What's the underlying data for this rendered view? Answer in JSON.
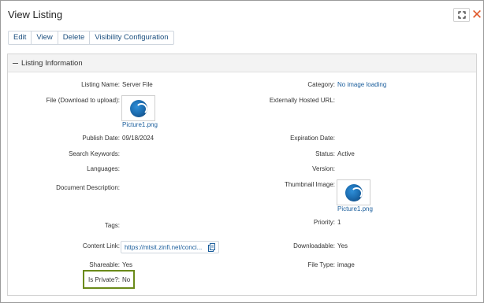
{
  "window": {
    "title": "View Listing"
  },
  "toolbar": {
    "edit": "Edit",
    "view": "View",
    "delete": "Delete",
    "visibility": "Visibility Configuration"
  },
  "panel": {
    "title": "Listing Information"
  },
  "fields": {
    "listing_name": {
      "label": "Listing Name:",
      "value": "Server File"
    },
    "category": {
      "label": "Category:",
      "value": "No image loading"
    },
    "file": {
      "label": "File (Download to upload):",
      "value": "Picture1.png"
    },
    "externally_hosted_url": {
      "label": "Externally Hosted URL:",
      "value": ""
    },
    "publish_date": {
      "label": "Publish Date:",
      "value": "09/18/2024"
    },
    "expiration_date": {
      "label": "Expiration Date:",
      "value": ""
    },
    "search_keywords": {
      "label": "Search Keywords:",
      "value": ""
    },
    "status": {
      "label": "Status:",
      "value": "Active"
    },
    "languages": {
      "label": "Languages:",
      "value": ""
    },
    "version": {
      "label": "Version:",
      "value": ""
    },
    "document_description": {
      "label": "Document Description:",
      "value": ""
    },
    "thumbnail_image": {
      "label": "Thumbnail Image:",
      "value": "Picture1.png"
    },
    "tags": {
      "label": "Tags:",
      "value": ""
    },
    "priority": {
      "label": "Priority:",
      "value": "1"
    },
    "content_link": {
      "label": "Content Link:",
      "value": "https://mtsit.zinfi.net/conci..."
    },
    "downloadable": {
      "label": "Downloadable:",
      "value": "Yes"
    },
    "shareable": {
      "label": "Shareable:",
      "value": "Yes"
    },
    "file_type": {
      "label": "File Type:",
      "value": "image"
    },
    "is_private": {
      "label": "Is Private?:",
      "value": "No"
    }
  },
  "icons": {
    "expand": "expand-icon",
    "close": "close-icon",
    "collapse": "minus-icon",
    "copy": "copy-icon",
    "file_thumbnail": "image-thumbnail-icon"
  },
  "colors": {
    "link": "#1b5e9c",
    "close": "#e05a2c",
    "highlight": "#6a8a19"
  }
}
